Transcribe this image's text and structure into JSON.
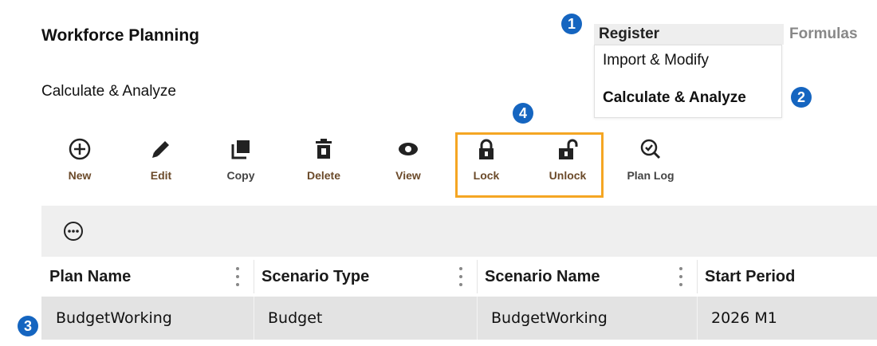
{
  "header": {
    "title": "Workforce Planning",
    "subtitle": "Calculate & Analyze"
  },
  "menu": {
    "register_label": "Register",
    "formulas_label": "Formulas",
    "dropdown_items": [
      "Import & Modify",
      "Calculate & Analyze"
    ],
    "active_item": "Calculate & Analyze"
  },
  "callouts": {
    "badge_1": "1",
    "badge_2": "2",
    "badge_3": "3",
    "badge_4": "4",
    "badge_color": "#1565c0",
    "highlight_color": "#f5a623"
  },
  "toolbar": {
    "new_label": "New",
    "edit_label": "Edit",
    "copy_label": "Copy",
    "delete_label": "Delete",
    "view_label": "View",
    "lock_label": "Lock",
    "unlock_label": "Unlock",
    "plan_log_label": "Plan Log",
    "icons": [
      "plus-circle-icon",
      "pencil-icon",
      "copy-icon",
      "trash-icon",
      "eye-icon",
      "lock-icon",
      "unlock-icon",
      "search-check-icon"
    ]
  },
  "table": {
    "columns": [
      "Plan Name",
      "Scenario Type",
      "Scenario Name",
      "Start Period"
    ],
    "rows": [
      [
        "BudgetWorking",
        "Budget",
        "BudgetWorking",
        "2026 M1"
      ]
    ]
  }
}
